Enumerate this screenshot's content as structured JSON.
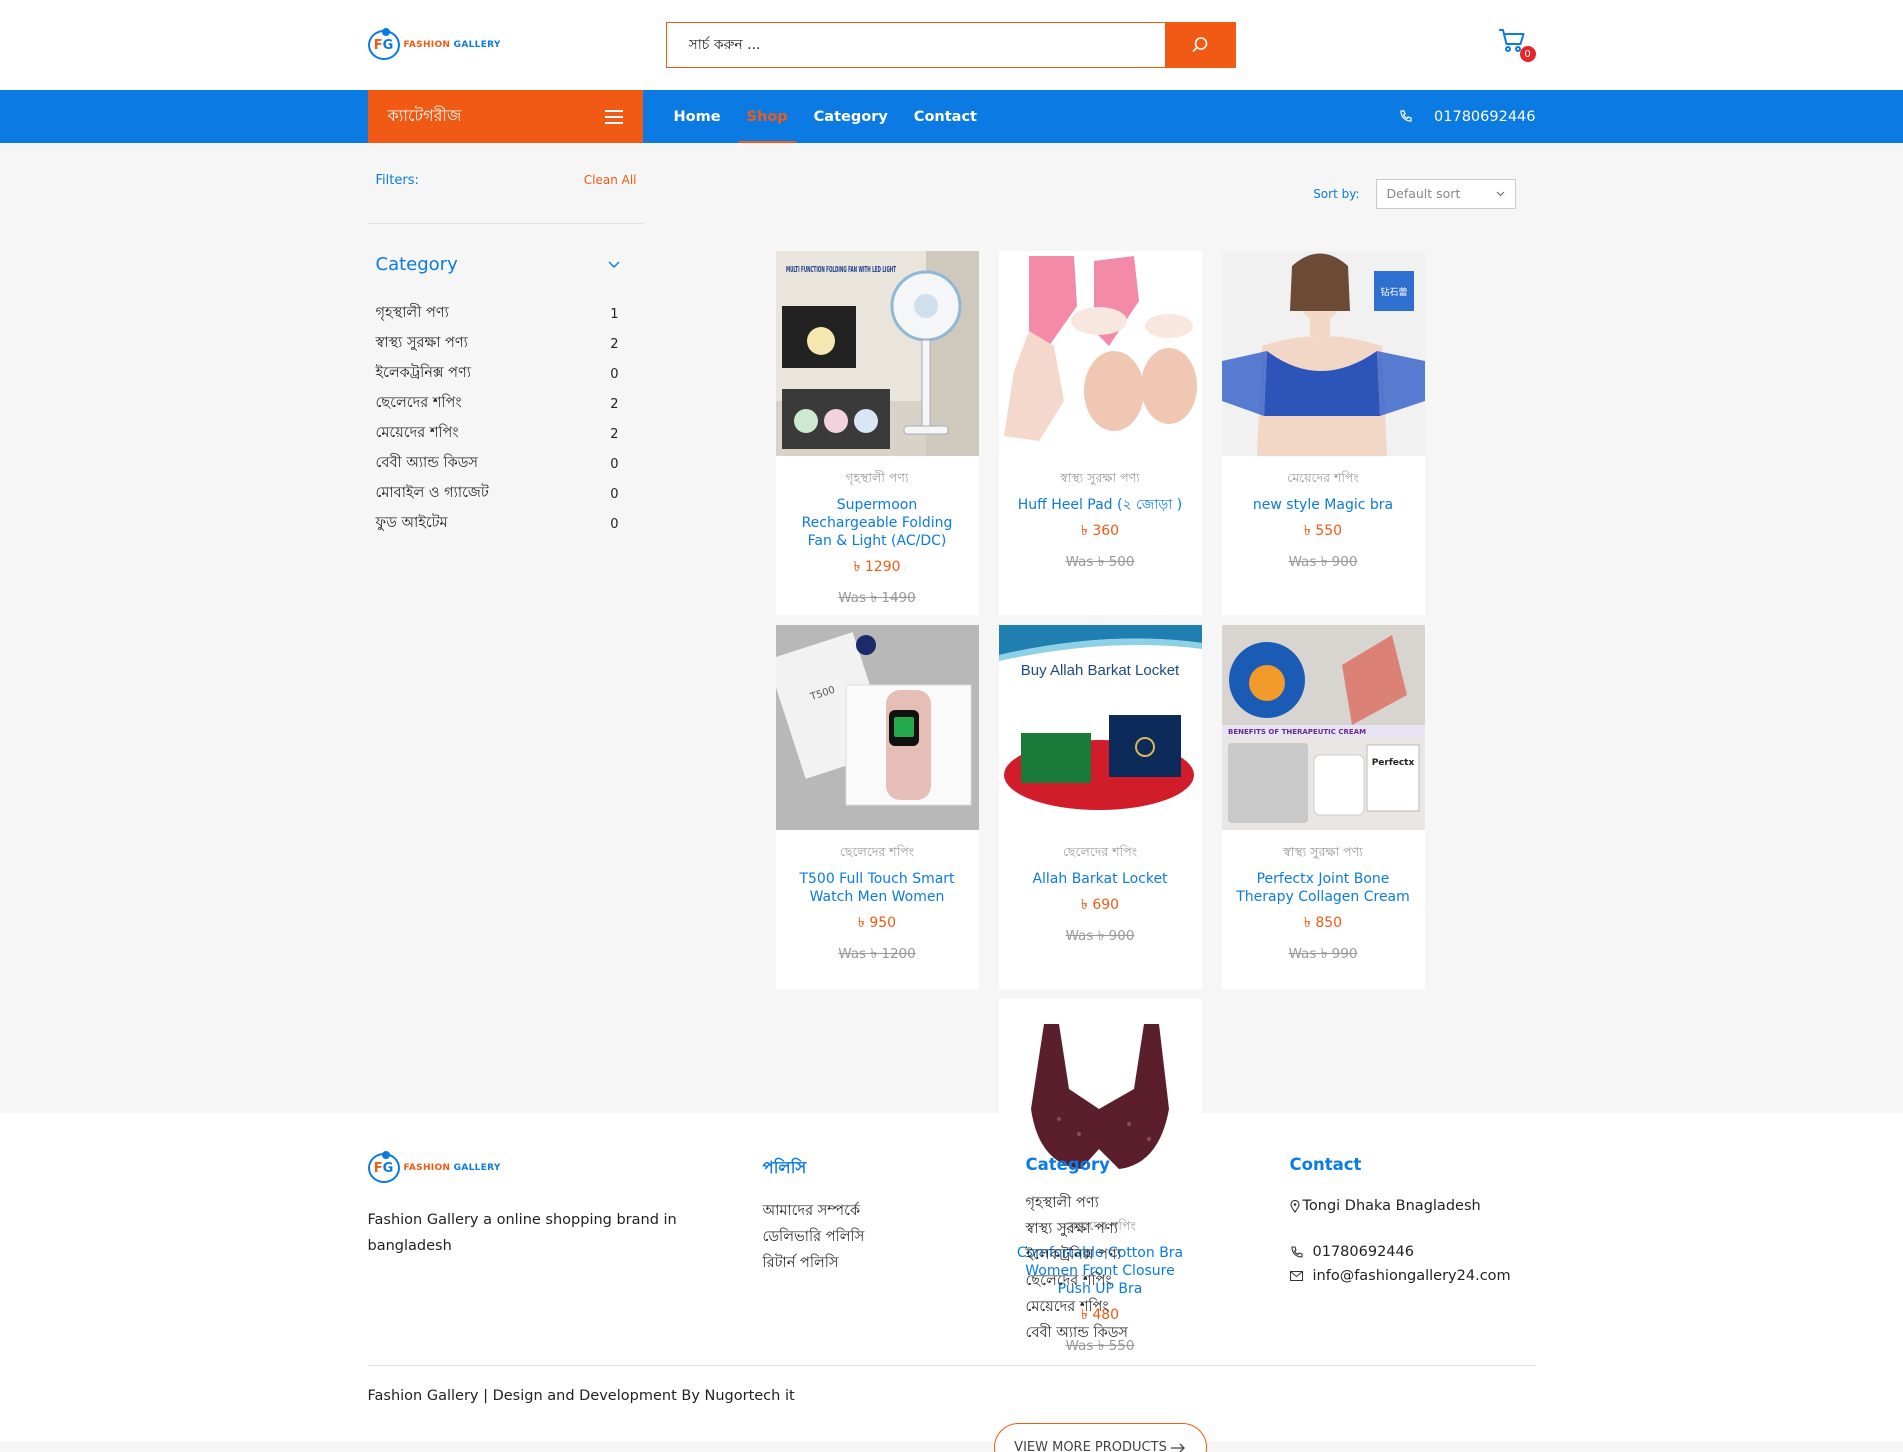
{
  "brand": {
    "logo_letters_f": "F",
    "logo_letters_g": "G",
    "name_part1": "FASHION",
    "name_part2": "GALLERY"
  },
  "header": {
    "search_placeholder": "সার্চ করুন ...",
    "cart_count": "0"
  },
  "nav": {
    "categories_label": "ক্যাটেগরীজ",
    "items": [
      {
        "label": "Home"
      },
      {
        "label": "Shop"
      },
      {
        "label": "Category"
      },
      {
        "label": "Contact"
      }
    ],
    "phone": "01780692446"
  },
  "sidebar": {
    "filters_label": "Filters:",
    "clear_all": "Clean All",
    "category_title": "Category",
    "categories": [
      {
        "name": "গৃহস্থালী পণ্য",
        "count": "1"
      },
      {
        "name": "স্বাস্থ্য সুরক্ষা পণ্য",
        "count": "2"
      },
      {
        "name": "ইলেকট্রনিক্স পণ্য",
        "count": "0"
      },
      {
        "name": "ছেলেদের শপিং",
        "count": "2"
      },
      {
        "name": "মেয়েদের শপিং",
        "count": "2"
      },
      {
        "name": "বেবী অ্যান্ড কিডস",
        "count": "0"
      },
      {
        "name": "মোবাইল ও গ্যাজেট",
        "count": "0"
      },
      {
        "name": "ফুড আইটেম",
        "count": "0"
      }
    ]
  },
  "sort": {
    "label": "Sort by:",
    "value": "Default sort"
  },
  "products": [
    {
      "category": "গৃহস্থালী পণ্য",
      "name": "Supermoon Rechargeable Folding Fan & Light (AC/DC)",
      "price": "৳ 1290",
      "was": "Was ৳ 1490",
      "img_text": "MULTI FUNCTION FOLDING FAN WITH LED LIGHT"
    },
    {
      "category": "স্বাস্থ্য সুরক্ষা পণ্য",
      "name": "Huff Heel Pad (২ জোড়া )",
      "price": "৳ 360",
      "was": "Was ৳ 500"
    },
    {
      "category": "মেয়েদের শপিং",
      "name": "new style Magic bra",
      "price": "৳ 550",
      "was": "Was ৳ 900",
      "img_text": "钻石蕾"
    },
    {
      "category": "ছেলেদের শপিং",
      "name": "T500 Full Touch Smart Watch Men Women",
      "price": "৳ 950",
      "was": "Was ৳ 1200",
      "img_text": "T500"
    },
    {
      "category": "ছেলেদের শপিং",
      "name": "Allah Barkat Locket",
      "price": "৳ 690",
      "was": "Was ৳ 900",
      "img_text": "Buy Allah Barkat Locket"
    },
    {
      "category": "স্বাস্থ্য সুরক্ষা পণ্য",
      "name": "Perfectx Joint Bone Therapy Collagen Cream",
      "price": "৳ 850",
      "was": "Was ৳ 990",
      "img_text": "BENEFITS OF THERAPEUTIC CREAM",
      "img_text2": "Perfectx"
    },
    {
      "category": "মেয়েদের শপিং",
      "name": "Comfortable Cotton Bra Women Front Closure Push UP Bra",
      "price": "৳ 480",
      "was": "Was ৳ 550"
    }
  ],
  "view_more": "VIEW MORE PRODUCTS",
  "footer": {
    "description": "Fashion Gallery a online shopping brand in bangladesh",
    "policy_title": "পলিসি",
    "policy_links": [
      "আমাদের সম্পর্কে",
      "ডেলিভারি পলিসি",
      "রিটার্ন পলিসি"
    ],
    "category_title": "Category",
    "category_links": [
      "গৃহস্থালী পণ্য",
      "স্বাস্থ্য সুরক্ষা পণ্য",
      "ইলেকট্রনিক্স পণ্য",
      "ছেলেদের শপিং",
      "মেয়েদের শপিং",
      "বেবী অ্যান্ড কিডস"
    ],
    "contact_title": "Contact",
    "address": "Tongi Dhaka Bnagladesh",
    "phone": "01780692446",
    "email": "info@fashiongallery24.com",
    "copyright": "Fashion Gallery | Design and Development By Nugortech it"
  },
  "colors": {
    "primary": "#0b7be3",
    "accent": "#f05a14"
  }
}
